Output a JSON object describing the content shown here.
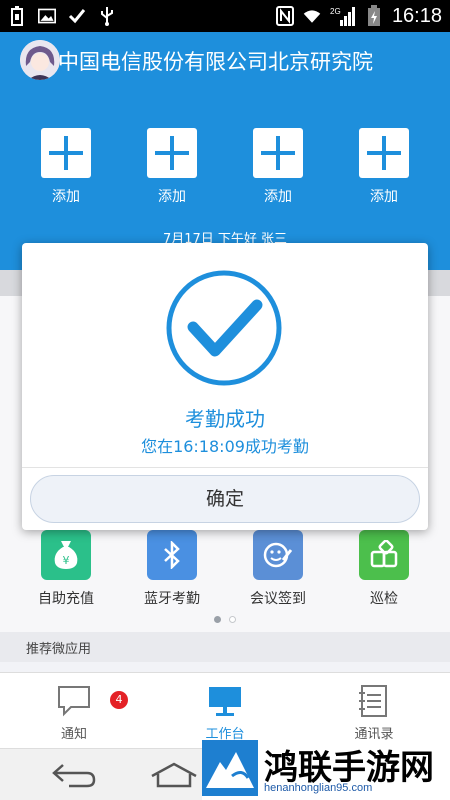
{
  "status_bar": {
    "time": "16:18",
    "network": "2G",
    "left_icons": [
      "usb-battery-icon",
      "image-icon",
      "check-icon",
      "usb-icon"
    ],
    "right_icons": [
      "nfc-icon",
      "wifi-icon",
      "signal-icon",
      "battery-icon"
    ]
  },
  "header": {
    "org_name": "中国电信股份有限公司北京研究院",
    "quick_add": [
      {
        "label": "添加"
      },
      {
        "label": "添加"
      },
      {
        "label": "添加"
      },
      {
        "label": "添加"
      }
    ],
    "greeting": "7月17日 下午好 张三",
    "color": "#1e8fdc"
  },
  "apps": [
    {
      "label": "自助充值",
      "icon": "money-bag-icon",
      "color": "#2bc08a"
    },
    {
      "label": "蓝牙考勤",
      "icon": "bluetooth-icon",
      "color": "#4a90e2"
    },
    {
      "label": "会议签到",
      "icon": "meeting-checkin-icon",
      "color": "#5b8fd6"
    },
    {
      "label": "巡检",
      "icon": "inspection-icon",
      "color": "#4cbf4c"
    }
  ],
  "pager": {
    "count": 2,
    "active": 0
  },
  "section": {
    "recommended_title": "推荐微应用"
  },
  "tabbar": {
    "tabs": [
      {
        "label": "通知",
        "icon": "chat-bubble-icon",
        "badge": "4"
      },
      {
        "label": "工作台",
        "icon": "workbench-icon"
      },
      {
        "label": "通讯录",
        "icon": "contacts-icon"
      }
    ]
  },
  "dialog": {
    "title": "考勤成功",
    "message": "您在16:18:09成功考勤",
    "confirm_label": "确定",
    "accent": "#1e8fdc"
  },
  "watermark": {
    "title": "鸿联手游网",
    "url": "henanhonglian95.com"
  }
}
